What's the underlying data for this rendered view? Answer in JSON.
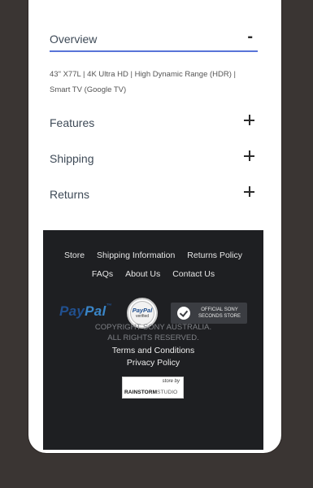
{
  "accordion": {
    "overview": {
      "title": "Overview",
      "toggle": "-",
      "description": "43\" X77L | 4K Ultra HD | High Dynamic Range (HDR) | Smart TV (Google TV)"
    },
    "sections": [
      {
        "label": "Features"
      },
      {
        "label": "Shipping"
      },
      {
        "label": "Returns"
      }
    ]
  },
  "footer": {
    "links_row1": [
      "Store",
      "Shipping Information",
      "Returns Policy"
    ],
    "links_row2": [
      "FAQs",
      "About Us",
      "Contact Us"
    ],
    "paypal": {
      "pay": "Pay",
      "pal": "Pal",
      "mark": "™"
    },
    "paypal_seal": {
      "title": "PayPal",
      "subtitle": "verified"
    },
    "sony_badge": {
      "line1": "OFFICIAL SONY",
      "line2": "SECONDS STORE"
    },
    "copyright_line1": "COPYRIGHT SONY AUSTRALIA.",
    "copyright_line2": "ALL RIGHTS RESERVED.",
    "terms": "Terms and Conditions",
    "privacy": "Privacy Policy",
    "store_by": {
      "label": "store by",
      "brand_bold": "RAINSTORM",
      "brand_rest": "STUDIO"
    }
  },
  "colors": {
    "page_bg": "#3a3533",
    "accent_underline": "#5874d8",
    "footer_bg": "#1e1f22"
  }
}
